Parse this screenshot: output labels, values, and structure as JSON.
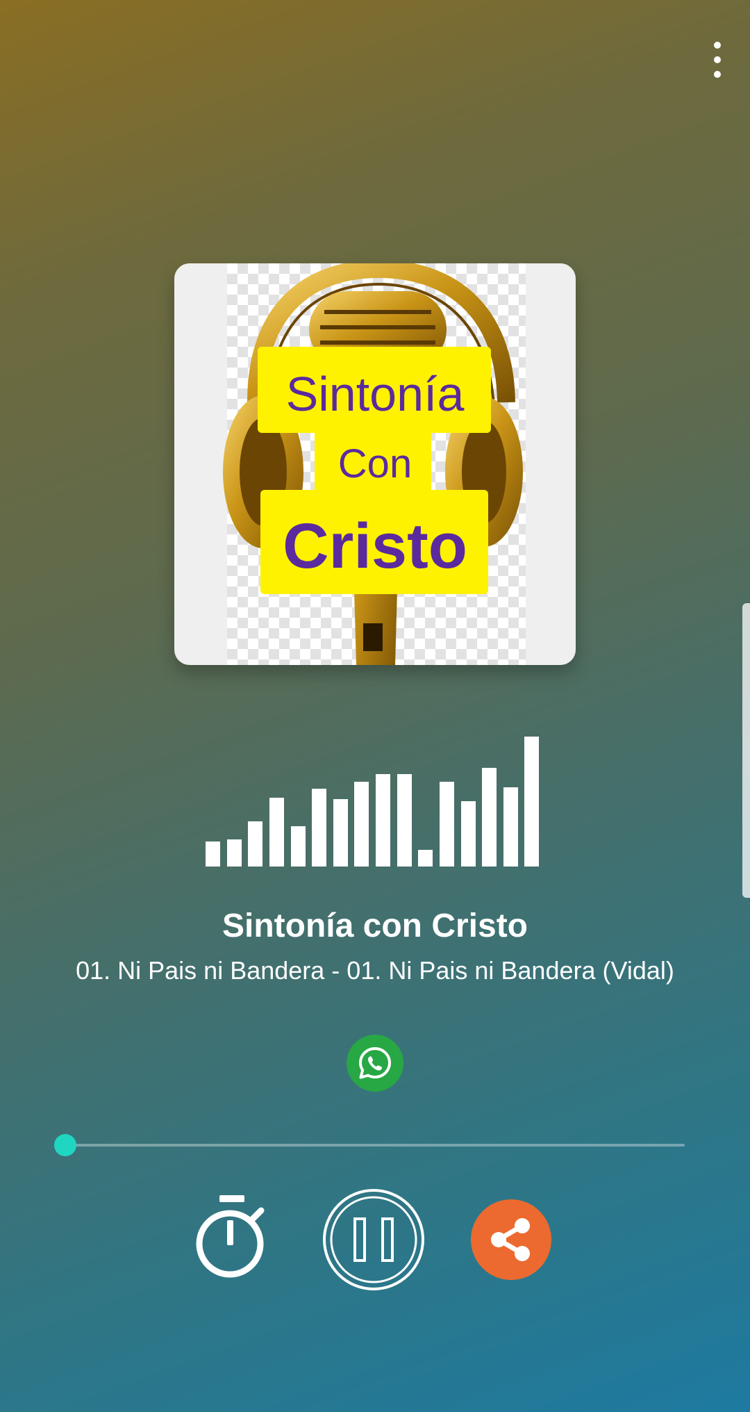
{
  "station": {
    "name": "Sintonía con Cristo",
    "now_playing": "01. Ni Pais ni Bandera - 01. Ni Pais ni Bandera (Vidal)"
  },
  "cover": {
    "line1": "Sintonía",
    "line2": "Con",
    "line3": "Cristo"
  },
  "visualizer": {
    "levels": [
      0.19,
      0.21,
      0.35,
      0.53,
      0.31,
      0.6,
      0.52,
      0.65,
      0.71,
      0.71,
      0.13,
      0.65,
      0.5,
      0.76,
      0.61,
      1.0
    ]
  },
  "playback": {
    "progress": 0.0,
    "state": "playing"
  },
  "icons": {
    "menu": "more-vert-icon",
    "whatsapp": "whatsapp-icon",
    "timer": "timer-icon",
    "pause": "pause-icon",
    "share": "share-icon"
  },
  "colors": {
    "accent": "#20d6c0",
    "whatsapp": "#28a745",
    "share": "#ec6a2f",
    "logo_text": "#5a2a9e",
    "logo_label_bg": "#fff200"
  }
}
